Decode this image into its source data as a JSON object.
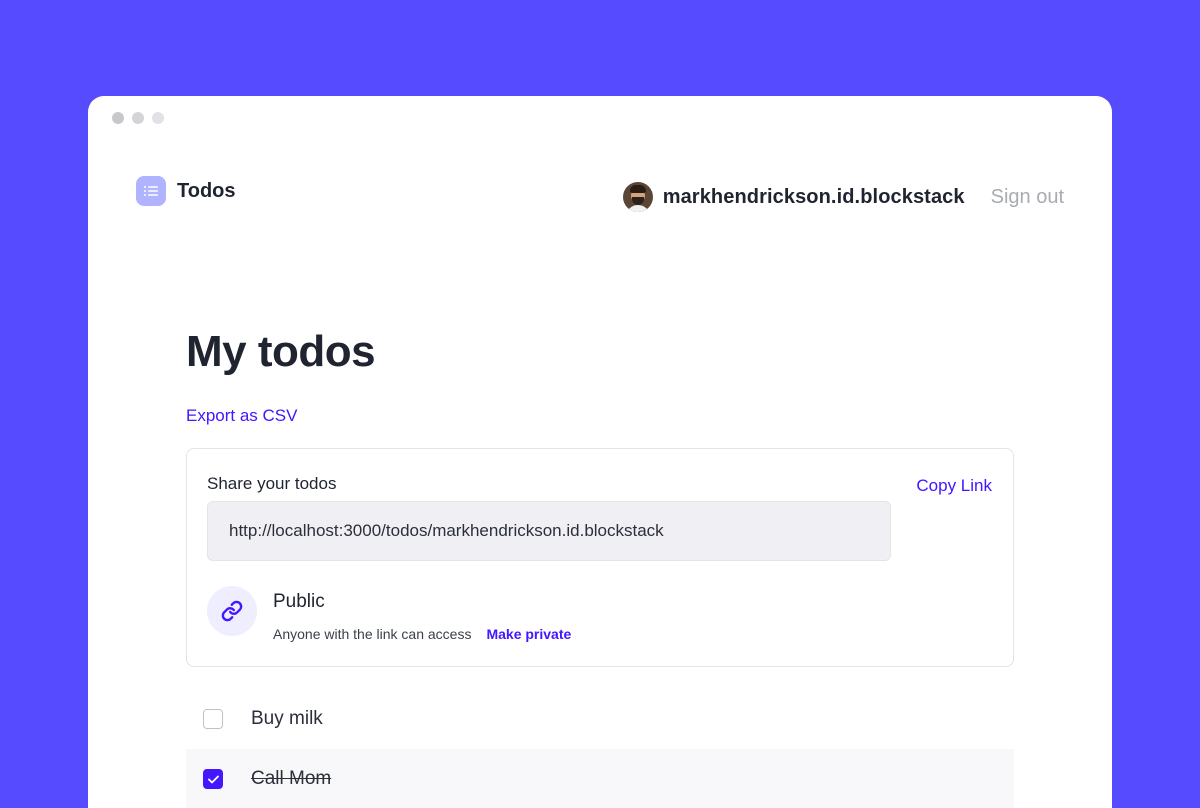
{
  "app": {
    "title": "Todos",
    "icon": "list-icon",
    "accent_color": "#574bff",
    "link_color": "#4417ff"
  },
  "header": {
    "username": "markhendrickson.id.blockstack",
    "sign_out_label": "Sign out"
  },
  "main": {
    "title": "My todos",
    "export_label": "Export as CSV"
  },
  "share": {
    "label": "Share your todos",
    "copy_label": "Copy Link",
    "url": "http://localhost:3000/todos/markhendrickson.id.blockstack",
    "privacy_icon": "link-icon",
    "privacy_title": "Public",
    "privacy_description": "Anyone with the link can access",
    "make_private_label": "Make private"
  },
  "todos": [
    {
      "text": "Buy milk",
      "done": false
    },
    {
      "text": "Call Mom",
      "done": true
    }
  ]
}
